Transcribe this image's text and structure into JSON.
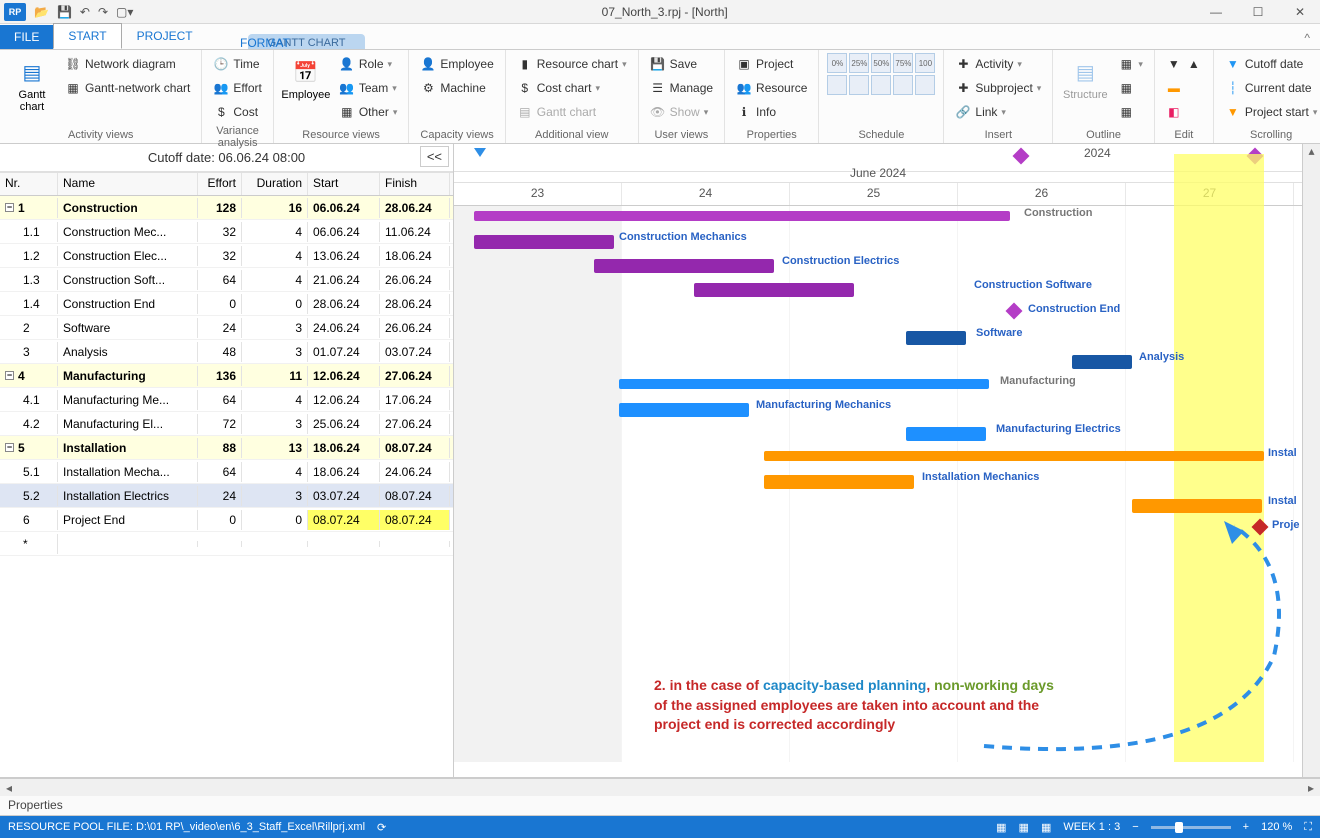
{
  "window": {
    "title": "07_North_3.rpj - [North]",
    "app_short": "RP"
  },
  "tabs": {
    "file": "FILE",
    "start": "START",
    "project": "PROJECT",
    "contextual_group": "GANTT CHART",
    "format": "FORMAT"
  },
  "ribbon": {
    "activity_views": {
      "label": "Activity views",
      "gantt": "Gantt chart",
      "network": "Network diagram",
      "ganttnet": "Gantt-network chart"
    },
    "variance_analysis": {
      "label": "Variance analysis",
      "time": "Time",
      "effort": "Effort",
      "cost": "Cost"
    },
    "resource_views": {
      "label": "Resource views",
      "employee": "Employee",
      "role": "Role",
      "team": "Team",
      "other": "Other"
    },
    "capacity_views": {
      "label": "Capacity views",
      "employee": "Employee",
      "machine": "Machine"
    },
    "additional_view": {
      "label": "Additional view",
      "resource_chart": "Resource chart",
      "cost_chart": "Cost chart",
      "gantt_chart": "Gantt chart"
    },
    "user_views": {
      "label": "User views",
      "save": "Save",
      "manage": "Manage",
      "show": "Show"
    },
    "properties": {
      "label": "Properties",
      "project": "Project",
      "resource": "Resource",
      "info": "Info"
    },
    "schedule": {
      "label": "Schedule",
      "cells": [
        "0%",
        "25%",
        "50%",
        "75%",
        "100%",
        "",
        "",
        "",
        "",
        ""
      ]
    },
    "insert": {
      "label": "Insert",
      "activity": "Activity",
      "subproject": "Subproject",
      "link": "Link"
    },
    "outline": {
      "label": "Outline",
      "structure": "Structure"
    },
    "edit": {
      "label": "Edit"
    },
    "scrolling": {
      "label": "Scrolling",
      "cutoff": "Cutoff date",
      "current": "Current date",
      "project_start": "Project start"
    }
  },
  "cutoff_label": "Cutoff date: 06.06.24 08:00",
  "collapse_btn": "<<",
  "table": {
    "headers": {
      "nr": "Nr.",
      "name": "Name",
      "effort": "Effort",
      "duration": "Duration",
      "start": "Start",
      "finish": "Finish"
    },
    "rows": [
      {
        "nr": "1",
        "name": "Construction",
        "effort": "128",
        "dur": "16",
        "start": "06.06.24",
        "finish": "28.06.24",
        "group": true
      },
      {
        "nr": "1.1",
        "name": "Construction Mec...",
        "effort": "32",
        "dur": "4",
        "start": "06.06.24",
        "finish": "11.06.24"
      },
      {
        "nr": "1.2",
        "name": "Construction Elec...",
        "effort": "32",
        "dur": "4",
        "start": "13.06.24",
        "finish": "18.06.24"
      },
      {
        "nr": "1.3",
        "name": "Construction Soft...",
        "effort": "64",
        "dur": "4",
        "start": "21.06.24",
        "finish": "26.06.24"
      },
      {
        "nr": "1.4",
        "name": "Construction End",
        "effort": "0",
        "dur": "0",
        "start": "28.06.24",
        "finish": "28.06.24"
      },
      {
        "nr": "2",
        "name": "Software",
        "effort": "24",
        "dur": "3",
        "start": "24.06.24",
        "finish": "26.06.24"
      },
      {
        "nr": "3",
        "name": "Analysis",
        "effort": "48",
        "dur": "3",
        "start": "01.07.24",
        "finish": "03.07.24"
      },
      {
        "nr": "4",
        "name": "Manufacturing",
        "effort": "136",
        "dur": "11",
        "start": "12.06.24",
        "finish": "27.06.24",
        "group": true
      },
      {
        "nr": "4.1",
        "name": "Manufacturing Me...",
        "effort": "64",
        "dur": "4",
        "start": "12.06.24",
        "finish": "17.06.24"
      },
      {
        "nr": "4.2",
        "name": "Manufacturing El...",
        "effort": "72",
        "dur": "3",
        "start": "25.06.24",
        "finish": "27.06.24"
      },
      {
        "nr": "5",
        "name": "Installation",
        "effort": "88",
        "dur": "13",
        "start": "18.06.24",
        "finish": "08.07.24",
        "group": true
      },
      {
        "nr": "5.1",
        "name": "Installation Mecha...",
        "effort": "64",
        "dur": "4",
        "start": "18.06.24",
        "finish": "24.06.24"
      },
      {
        "nr": "5.2",
        "name": "Installation Electrics",
        "effort": "24",
        "dur": "3",
        "start": "03.07.24",
        "finish": "08.07.24",
        "sel": true
      },
      {
        "nr": "6",
        "name": "Project End",
        "effort": "0",
        "dur": "0",
        "start": "08.07.24",
        "finish": "08.07.24",
        "hl": true
      },
      {
        "nr": "*",
        "name": "",
        "effort": "",
        "dur": "",
        "start": "",
        "finish": ""
      }
    ]
  },
  "timeline": {
    "year": "2024",
    "month": "June 2024",
    "days": [
      "23",
      "24",
      "25",
      "26",
      "27"
    ]
  },
  "gantt_labels": {
    "construction": "Construction",
    "con_mech": "Construction Mechanics",
    "con_elec": "Construction Electrics",
    "con_soft": "Construction Software",
    "con_end": "Construction End",
    "software": "Software",
    "analysis": "Analysis",
    "manufacturing": "Manufacturing",
    "man_mech": "Manufacturing Mechanics",
    "man_elec": "Manufacturing Electrics",
    "installation": "Instal",
    "inst_mech": "Installation Mechanics",
    "inst_elec": "Instal",
    "project_end": "Proje"
  },
  "annotation": {
    "line1a": "2. in the case of ",
    "line1b": "capacity-based planning",
    "line1c": ", ",
    "line1d": "non-working days",
    "line2": "of the assigned employees are taken into account and the",
    "line3": "project end is corrected accordingly"
  },
  "props_label": "Properties",
  "status": {
    "pool": "RESOURCE POOL FILE: D:\\01 RP\\_video\\en\\6_3_Staff_Excel\\Rillprj.xml",
    "week": "WEEK 1 : 3",
    "zoom": "120 %"
  },
  "chart_data": {
    "type": "gantt",
    "timeline": {
      "unit": "day",
      "visible_start": "2024-06-23",
      "visible_end": "2024-06-27",
      "cutoff": "2024-06-06 08:00"
    },
    "tasks": [
      {
        "id": "1",
        "name": "Construction",
        "start": "2024-06-06",
        "finish": "2024-06-28",
        "effort": 128,
        "dur": 16,
        "summary": true,
        "color": "#b43dc6"
      },
      {
        "id": "1.1",
        "name": "Construction Mechanics",
        "start": "2024-06-06",
        "finish": "2024-06-11",
        "effort": 32,
        "dur": 4,
        "color": "#b43dc6"
      },
      {
        "id": "1.2",
        "name": "Construction Electrics",
        "start": "2024-06-13",
        "finish": "2024-06-18",
        "effort": 32,
        "dur": 4,
        "color": "#b43dc6"
      },
      {
        "id": "1.3",
        "name": "Construction Software",
        "start": "2024-06-21",
        "finish": "2024-06-26",
        "effort": 64,
        "dur": 4,
        "color": "#b43dc6"
      },
      {
        "id": "1.4",
        "name": "Construction End",
        "start": "2024-06-28",
        "finish": "2024-06-28",
        "effort": 0,
        "dur": 0,
        "milestone": true,
        "color": "#b43dc6"
      },
      {
        "id": "2",
        "name": "Software",
        "start": "2024-06-24",
        "finish": "2024-06-26",
        "effort": 24,
        "dur": 3,
        "color": "#1857a4"
      },
      {
        "id": "3",
        "name": "Analysis",
        "start": "2024-07-01",
        "finish": "2024-07-03",
        "effort": 48,
        "dur": 3,
        "color": "#1857a4"
      },
      {
        "id": "4",
        "name": "Manufacturing",
        "start": "2024-06-12",
        "finish": "2024-06-27",
        "effort": 136,
        "dur": 11,
        "summary": true,
        "color": "#1e90ff"
      },
      {
        "id": "4.1",
        "name": "Manufacturing Mechanics",
        "start": "2024-06-12",
        "finish": "2024-06-17",
        "effort": 64,
        "dur": 4,
        "color": "#1e90ff"
      },
      {
        "id": "4.2",
        "name": "Manufacturing Electrics",
        "start": "2024-06-25",
        "finish": "2024-06-27",
        "effort": 72,
        "dur": 3,
        "color": "#1e90ff"
      },
      {
        "id": "5",
        "name": "Installation",
        "start": "2024-06-18",
        "finish": "2024-07-08",
        "effort": 88,
        "dur": 13,
        "summary": true,
        "color": "#ff9800"
      },
      {
        "id": "5.1",
        "name": "Installation Mechanics",
        "start": "2024-06-18",
        "finish": "2024-06-24",
        "effort": 64,
        "dur": 4,
        "color": "#ff9800"
      },
      {
        "id": "5.2",
        "name": "Installation Electrics",
        "start": "2024-07-03",
        "finish": "2024-07-08",
        "effort": 24,
        "dur": 3,
        "color": "#ff9800"
      },
      {
        "id": "6",
        "name": "Project End",
        "start": "2024-07-08",
        "finish": "2024-07-08",
        "effort": 0,
        "dur": 0,
        "milestone": true,
        "color": "#c62828"
      }
    ]
  }
}
